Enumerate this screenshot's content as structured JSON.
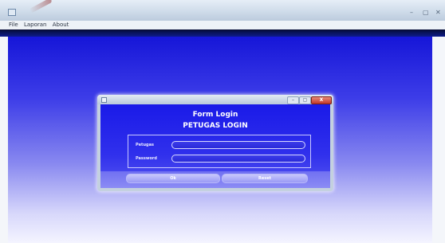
{
  "window": {
    "controls": [
      "–",
      "▢",
      "✕"
    ]
  },
  "menu": {
    "items": [
      "File",
      "Laporan",
      "About"
    ]
  },
  "dialog": {
    "controls": [
      "–",
      "▢",
      "X"
    ],
    "form_title": "Form Login",
    "form_subtitle": "PETUGAS LOGIN",
    "fields": {
      "petugas_label": "Petugas",
      "petugas_value": "",
      "password_label": "Password",
      "password_value": ""
    },
    "buttons": {
      "ok": "Ok",
      "reset": "Reset"
    }
  },
  "colors": {
    "desktop_top": "#1616d8",
    "desktop_bottom": "#f4f4ff",
    "dialog_body": "#1a1ae8",
    "button": "#9a9af5"
  }
}
